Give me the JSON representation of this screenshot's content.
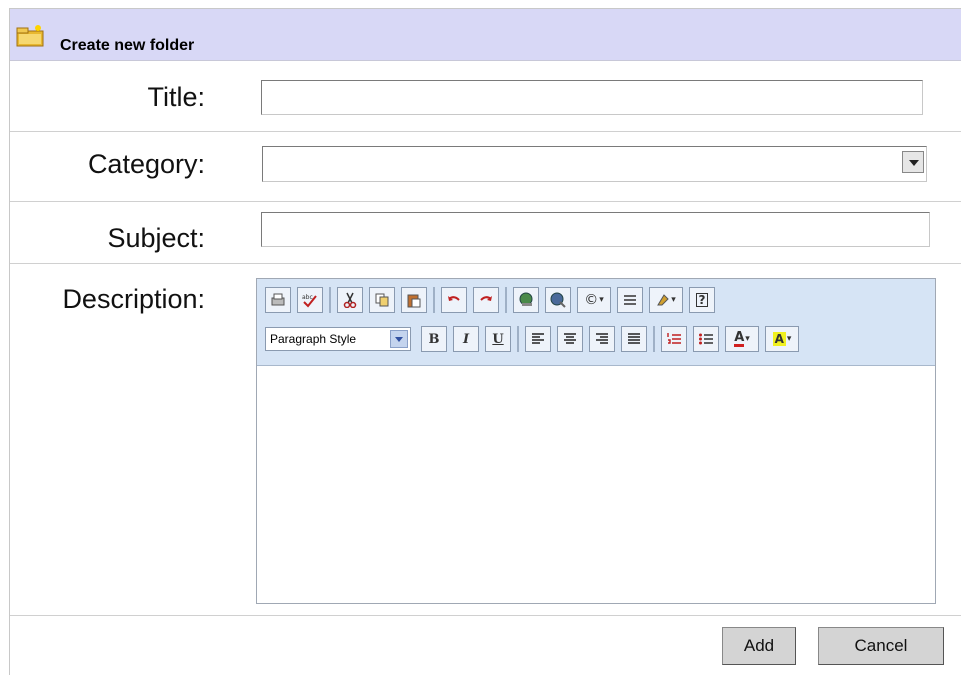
{
  "header": {
    "title": "Create new folder",
    "icon": "folder-new-icon"
  },
  "fields": {
    "title": {
      "label": "Title:",
      "value": ""
    },
    "category": {
      "label": "Category:",
      "value": ""
    },
    "subject": {
      "label": "Subject:",
      "value": ""
    },
    "description": {
      "label": "Description:",
      "value": ""
    }
  },
  "editor": {
    "paragraph_style": "Paragraph Style",
    "toolbar_row1": [
      "print-icon",
      "spellcheck-icon",
      "cut-icon",
      "copy-icon",
      "paste-icon",
      "undo-icon",
      "redo-icon",
      "insert-link-icon",
      "remove-link-icon",
      "special-char-icon",
      "horizontal-rule-icon",
      "clean-format-icon",
      "help-icon"
    ],
    "toolbar_row2": [
      "bold-icon",
      "italic-icon",
      "underline-icon",
      "align-left-icon",
      "align-center-icon",
      "align-right-icon",
      "justify-icon",
      "numbered-list-icon",
      "bulleted-list-icon",
      "text-color-icon",
      "highlight-color-icon"
    ],
    "bold": "B",
    "italic": "I",
    "underline": "U"
  },
  "buttons": {
    "add": "Add",
    "cancel": "Cancel"
  }
}
